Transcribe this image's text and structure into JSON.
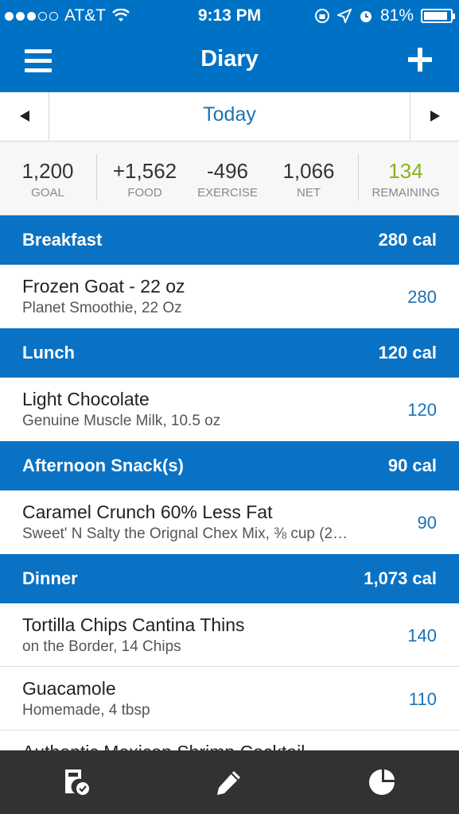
{
  "status_bar": {
    "carrier": "AT&T",
    "time": "9:13 PM",
    "battery": "81%"
  },
  "nav": {
    "title": "Diary",
    "menu_icon": "hamburger-menu-icon",
    "add_icon": "plus-icon"
  },
  "date_bar": {
    "date": "Today"
  },
  "summary": [
    {
      "value": "1,200",
      "label": "GOAL"
    },
    {
      "value": "+1,562",
      "label": "FOOD"
    },
    {
      "value": "-496",
      "label": "EXERCISE"
    },
    {
      "value": "1,066",
      "label": "NET"
    },
    {
      "value": "134",
      "label": "REMAINING"
    }
  ],
  "colors": {
    "brand_blue": "#0072c6",
    "remaining_green": "#8bb31a",
    "tabbar": "#323232"
  },
  "meals": [
    {
      "name": "Breakfast",
      "calories": "280 cal",
      "entries": [
        {
          "name": "Frozen Goat - 22 oz",
          "desc": "Planet Smoothie, 22 Oz",
          "cal": "280"
        }
      ]
    },
    {
      "name": "Lunch",
      "calories": "120 cal",
      "entries": [
        {
          "name": "Light Chocolate",
          "desc": "Genuine Muscle Milk, 10.5 oz",
          "cal": "120"
        }
      ]
    },
    {
      "name": "Afternoon Snack(s)",
      "calories": "90 cal",
      "entries": [
        {
          "name": "Caramel Crunch 60% Less Fat",
          "desc": "Sweet' N Salty the Orignal Chex Mix, ⅜ cup (2…",
          "cal": "90"
        }
      ]
    },
    {
      "name": "Dinner",
      "calories": "1,073 cal",
      "entries": [
        {
          "name": "Tortilla Chips Cantina Thins",
          "desc": "on the Border, 14 Chips",
          "cal": "140"
        },
        {
          "name": "Guacamole",
          "desc": "Homemade, 4 tbsp",
          "cal": "110"
        },
        {
          "name": "Authentic Mexican Shrimp Cocktail",
          "desc": "",
          "cal": ""
        }
      ]
    }
  ],
  "tabbar": {
    "tabs": [
      "diary-check-icon",
      "pencil-icon",
      "pie-chart-icon"
    ]
  }
}
